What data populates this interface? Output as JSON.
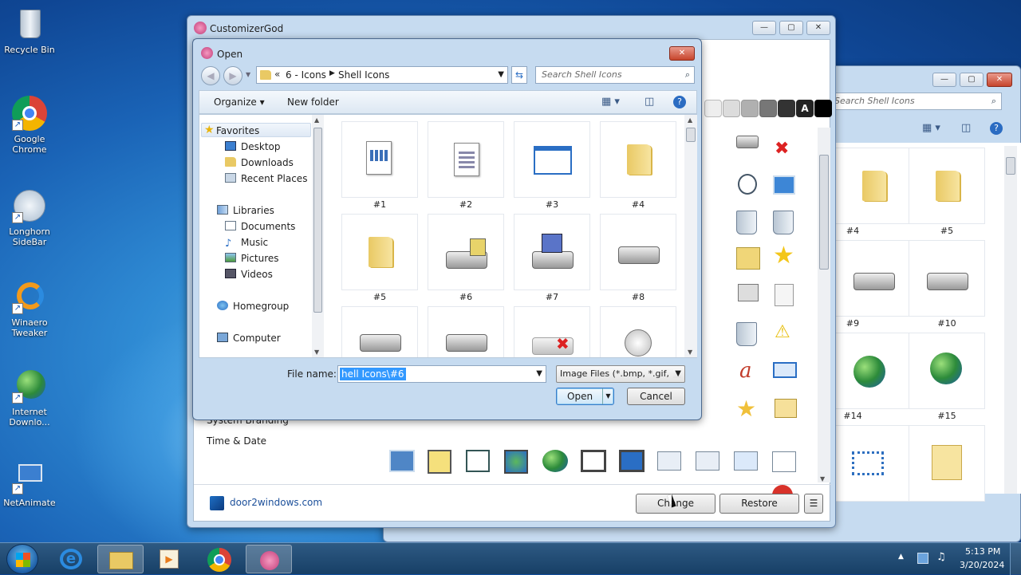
{
  "desktop": {
    "icons": [
      {
        "label": "Recycle Bin"
      },
      {
        "label": "Google Chrome"
      },
      {
        "label": "Longhorn SideBar"
      },
      {
        "label": "Winaero Tweaker"
      },
      {
        "label": "Internet Downlo..."
      },
      {
        "label": "NetAnimate"
      }
    ]
  },
  "main_window": {
    "title": "CustomizerGod",
    "sidebar_items": [
      "System Branding",
      "Time & Date"
    ],
    "footer_link": "door2windows.com",
    "change_label": "Change",
    "restore_label": "Restore",
    "menu_label": "☰"
  },
  "bg_dialog": {
    "search_placeholder": "Search Shell Icons",
    "icons": [
      "#4",
      "#5",
      "#9",
      "#10",
      "#14",
      "#15"
    ]
  },
  "open_dialog": {
    "title": "Open",
    "breadcrumb_prefix": "«",
    "breadcrumb": [
      "6 - Icons",
      "Shell Icons"
    ],
    "search_placeholder": "Search Shell Icons",
    "toolbar": {
      "organize": "Organize ▾",
      "new_folder": "New folder"
    },
    "nav": {
      "favorites": "Favorites",
      "favorites_items": [
        "Desktop",
        "Downloads",
        "Recent Places"
      ],
      "libraries": "Libraries",
      "libraries_items": [
        "Documents",
        "Music",
        "Pictures",
        "Videos"
      ],
      "homegroup": "Homegroup",
      "computer": "Computer"
    },
    "files": [
      "#1",
      "#2",
      "#3",
      "#4",
      "#5",
      "#6",
      "#7",
      "#8"
    ],
    "file_name_label": "File name:",
    "file_name_value": "hell Icons\\#6",
    "file_type_value": "Image Files (*.bmp, *.gif,",
    "open_label": "Open",
    "cancel_label": "Cancel"
  },
  "taskbar": {
    "time": "5:13 PM",
    "date": "3/20/2024"
  },
  "colors": {
    "selection": "#3399ff",
    "accent": "#2a6ec4"
  }
}
